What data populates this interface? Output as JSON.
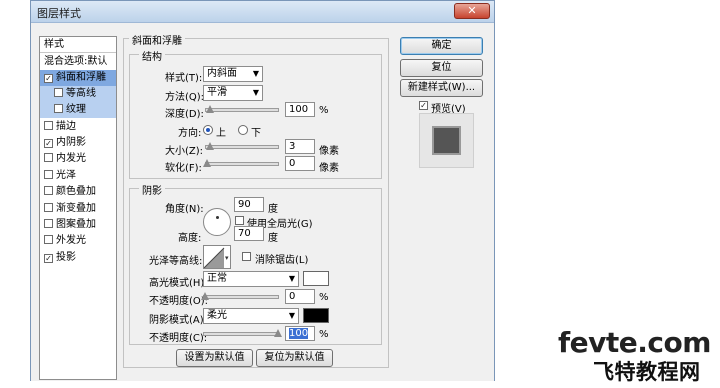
{
  "window": {
    "title": "图层样式",
    "close_glyph": "✕"
  },
  "stylelist": {
    "header": "样式",
    "items": [
      {
        "label": "混合选项:默认",
        "checkbox": false
      },
      {
        "label": "斜面和浮雕",
        "checkbox": true,
        "checked": true,
        "selected": true
      },
      {
        "label": "等高线",
        "checkbox": true,
        "checked": false,
        "sub": true
      },
      {
        "label": "纹理",
        "checkbox": true,
        "checked": false,
        "sub": true
      },
      {
        "label": "描边",
        "checkbox": true,
        "checked": false
      },
      {
        "label": "内阴影",
        "checkbox": true,
        "checked": true
      },
      {
        "label": "内发光",
        "checkbox": true,
        "checked": false
      },
      {
        "label": "光泽",
        "checkbox": true,
        "checked": false
      },
      {
        "label": "颜色叠加",
        "checkbox": true,
        "checked": false
      },
      {
        "label": "渐变叠加",
        "checkbox": true,
        "checked": false
      },
      {
        "label": "图案叠加",
        "checkbox": true,
        "checked": false
      },
      {
        "label": "外发光",
        "checkbox": true,
        "checked": false
      },
      {
        "label": "投影",
        "checkbox": true,
        "checked": true
      }
    ]
  },
  "bevel": {
    "group_title": "斜面和浮雕",
    "structure": {
      "group_title": "结构",
      "style_label": "样式(T):",
      "style_value": "内斜面",
      "technique_label": "方法(Q):",
      "technique_value": "平滑",
      "depth_label": "深度(D):",
      "depth_value": "100",
      "depth_unit": "%",
      "direction_label": "方向:",
      "direction_up": "上",
      "direction_down": "下",
      "size_label": "大小(Z):",
      "size_value": "3",
      "size_unit": "像素",
      "soften_label": "软化(F):",
      "soften_value": "0",
      "soften_unit": "像素"
    },
    "shading": {
      "group_title": "阴影",
      "angle_label": "角度(N):",
      "angle_value": "90",
      "angle_unit": "度",
      "global_light_label": "使用全局光(G)",
      "altitude_label": "高度:",
      "altitude_value": "70",
      "altitude_unit": "度",
      "gloss_label": "光泽等高线:",
      "antialias_label": "消除锯齿(L)",
      "highlight_mode_label": "高光模式(H):",
      "highlight_mode_value": "正常",
      "highlight_color": "#ffffff",
      "highlight_opacity_label": "不透明度(O):",
      "highlight_opacity_value": "0",
      "highlight_opacity_unit": "%",
      "shadow_mode_label": "阴影模式(A):",
      "shadow_mode_value": "柔光",
      "shadow_color": "#000000",
      "shadow_opacity_label": "不透明度(C):",
      "shadow_opacity_value": "100",
      "shadow_opacity_unit": "%"
    },
    "set_default": "设置为默认值",
    "reset_default": "复位为默认值"
  },
  "buttons": {
    "ok": "确定",
    "reset": "复位",
    "new_style": "新建样式(W)...",
    "preview": "预览(V)"
  },
  "watermark": {
    "line1": "fevte.com",
    "line2": "飞特教程网"
  }
}
